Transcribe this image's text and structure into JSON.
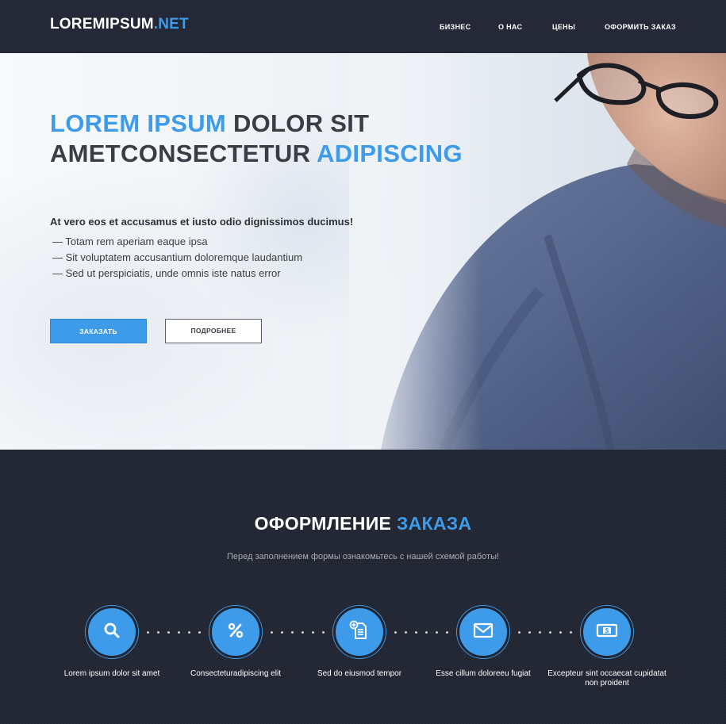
{
  "header": {
    "logo_main": "LOREMIPSUM",
    "logo_accent": ".NET",
    "nav": [
      "БИЗНЕС",
      "О НАС",
      "ЦЕНЫ",
      "ОФОРМИТЬ ЗАКАЗ"
    ]
  },
  "hero": {
    "title_part1": "LOREM IPSUM",
    "title_part2": " DOLOR SIT",
    "title_part3": "AMETCONSECTETUR ",
    "title_part4": "ADIPISCING",
    "lead": "At vero eos et accusamus et iusto odio dignissimos ducimus!",
    "list": [
      "Totam rem aperiam eaque ipsa",
      "Sit voluptatem accusantium doloremque laudantium",
      "Sed ut perspiciatis, unde omnis iste natus error"
    ],
    "btn_order": "ЗАКАЗАТЬ",
    "btn_more": "ПОДРОБНЕЕ"
  },
  "order": {
    "title_white": "ОФОРМЛЕНИЕ ",
    "title_blue": "ЗАКАЗА",
    "subtitle": "Перед заполнением формы ознакомьтесь с нашей схемой работы!",
    "steps": [
      {
        "label": "Lorem ipsum dolor sit amet",
        "icon": "search-icon"
      },
      {
        "label": "Consecteturadipiscing elit",
        "icon": "percent-icon"
      },
      {
        "label": "Sed do eiusmod tempor",
        "icon": "document-add-icon"
      },
      {
        "label": "Esse cillum doloreeu fugiat",
        "icon": "envelope-icon"
      },
      {
        "label": "Excepteur sint occaecat cupidatat non proident",
        "icon": "money-icon"
      }
    ]
  },
  "colors": {
    "accent": "#3d9be9",
    "dark_bg": "#232633",
    "text_dark": "#3a3d45"
  }
}
